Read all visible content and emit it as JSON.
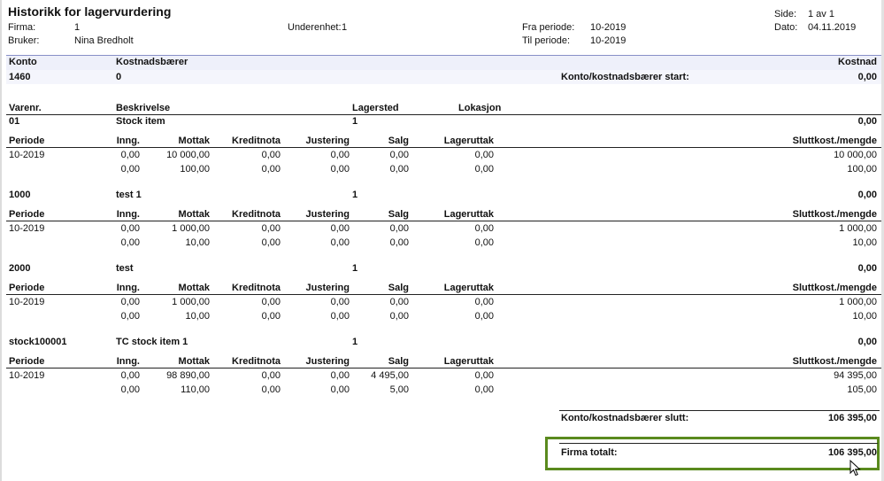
{
  "report": {
    "title": "Historikk for lagervurdering",
    "firma_label": "Firma:",
    "firma_value": "1",
    "bruker_label": "Bruker:",
    "bruker_value": "Nina Bredholt",
    "underenhet_label": "Underenhet:",
    "underenhet_value": "1",
    "fra_periode_label": "Fra periode:",
    "fra_periode_value": "10-2019",
    "til_periode_label": "Til periode:",
    "til_periode_value": "10-2019",
    "side_label": "Side:",
    "side_value": "1 av 1",
    "dato_label": "Dato:",
    "dato_value": "04.11.2019"
  },
  "konto_header": {
    "konto": "Konto",
    "kostnadsbaerer": "Kostnadsbærer",
    "kostnad": "Kostnad"
  },
  "konto_row": {
    "konto": "1460",
    "kostnadsbaerer": "0",
    "start_label": "Konto/kostnadsbærer start:",
    "start_value": "0,00"
  },
  "item_header": {
    "varenr": "Varenr.",
    "beskrivelse": "Beskrivelse",
    "lagersted": "Lagersted",
    "lokasjon": "Lokasjon"
  },
  "period_header": {
    "periode": "Periode",
    "inng": "Inng.",
    "mottak": "Mottak",
    "kreditnota": "Kreditnota",
    "justering": "Justering",
    "salg": "Salg",
    "lageruttak": "Lageruttak",
    "slutt": "Sluttkost./mengde"
  },
  "items": [
    {
      "varenr": "01",
      "beskrivelse": "Stock item",
      "lagersted": "1",
      "value": "0,00",
      "rows": [
        {
          "periode": "10-2019",
          "inng": "0,00",
          "mottak": "10 000,00",
          "kreditnota": "0,00",
          "justering": "0,00",
          "salg": "0,00",
          "lageruttak": "0,00",
          "slutt": "10 000,00"
        },
        {
          "periode": "",
          "inng": "0,00",
          "mottak": "100,00",
          "kreditnota": "0,00",
          "justering": "0,00",
          "salg": "0,00",
          "lageruttak": "0,00",
          "slutt": "100,00"
        }
      ]
    },
    {
      "varenr": "1000",
      "beskrivelse": "test 1",
      "lagersted": "1",
      "value": "0,00",
      "rows": [
        {
          "periode": "10-2019",
          "inng": "0,00",
          "mottak": "1 000,00",
          "kreditnota": "0,00",
          "justering": "0,00",
          "salg": "0,00",
          "lageruttak": "0,00",
          "slutt": "1 000,00"
        },
        {
          "periode": "",
          "inng": "0,00",
          "mottak": "10,00",
          "kreditnota": "0,00",
          "justering": "0,00",
          "salg": "0,00",
          "lageruttak": "0,00",
          "slutt": "10,00"
        }
      ]
    },
    {
      "varenr": "2000",
      "beskrivelse": "test",
      "lagersted": "1",
      "value": "0,00",
      "rows": [
        {
          "periode": "10-2019",
          "inng": "0,00",
          "mottak": "1 000,00",
          "kreditnota": "0,00",
          "justering": "0,00",
          "salg": "0,00",
          "lageruttak": "0,00",
          "slutt": "1 000,00"
        },
        {
          "periode": "",
          "inng": "0,00",
          "mottak": "10,00",
          "kreditnota": "0,00",
          "justering": "0,00",
          "salg": "0,00",
          "lageruttak": "0,00",
          "slutt": "10,00"
        }
      ]
    },
    {
      "varenr": "stock100001",
      "beskrivelse": "TC stock item 1",
      "lagersted": "1",
      "value": "0,00",
      "rows": [
        {
          "periode": "10-2019",
          "inng": "0,00",
          "mottak": "98 890,00",
          "kreditnota": "0,00",
          "justering": "0,00",
          "salg": "4 495,00",
          "lageruttak": "0,00",
          "slutt": "94 395,00"
        },
        {
          "periode": "",
          "inng": "0,00",
          "mottak": "110,00",
          "kreditnota": "0,00",
          "justering": "0,00",
          "salg": "5,00",
          "lageruttak": "0,00",
          "slutt": "105,00"
        }
      ]
    }
  ],
  "konto_slutt": {
    "label": "Konto/kostnadsbærer slutt:",
    "value": "106 395,00"
  },
  "firma_totalt": {
    "label": "Firma totalt:",
    "value": "106 395,00"
  },
  "colors": {
    "highlight": "#5a8a1e",
    "header_band": "#eef0fa"
  },
  "cursor_icon": "mouse-pointer-icon"
}
